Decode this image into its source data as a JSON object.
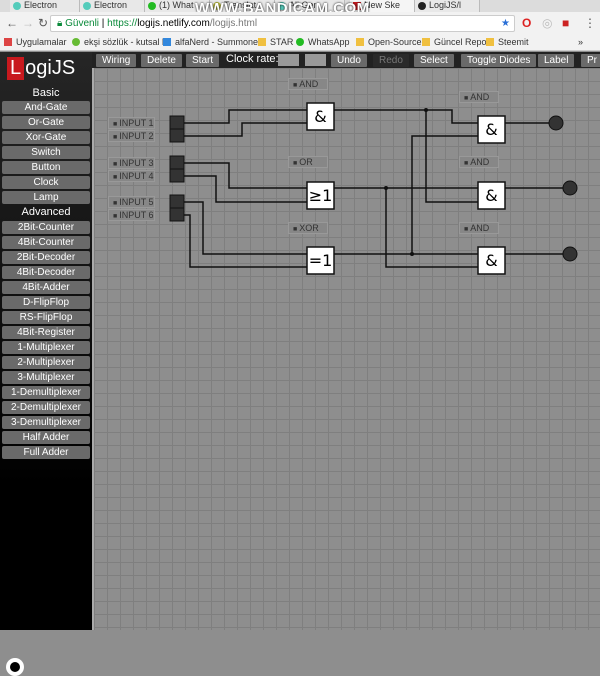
{
  "browser": {
    "tabs": [
      "Electron",
      "Electron",
      "(1) What",
      "Translat",
      "Ali Gen",
      "New Ske",
      "LogiJS/l"
    ],
    "watermark": "WWW.BANDICAM.COM",
    "security": "Güvenli",
    "url_scheme": "https://",
    "url_host": "logijs.netlify.com",
    "url_path": "/logijs.html",
    "bookmarks": [
      "Uygulamalar",
      "ekşi sözlük - kutsal b",
      "alfaNerd - Summone",
      "STAR",
      "WhatsApp",
      "Open-Source",
      "Güncel Repo",
      "Steemit"
    ],
    "more": "»"
  },
  "app": {
    "logo_letter": "L",
    "logo_rest": "ogiJS",
    "basic_heading": "Basic",
    "basic": [
      "And-Gate",
      "Or-Gate",
      "Xor-Gate",
      "Switch",
      "Button",
      "Clock",
      "Lamp"
    ],
    "advanced_heading": "Advanced",
    "advanced": [
      "2Bit-Counter",
      "4Bit-Counter",
      "2Bit-Decoder",
      "4Bit-Decoder",
      "4Bit-Adder",
      "D-FlipFlop",
      "RS-FlipFlop",
      "4Bit-Register",
      "1-Multiplexer",
      "2-Multiplexer",
      "3-Multiplexer",
      "1-Demultiplexer",
      "2-Demultiplexer",
      "3-Demultiplexer",
      "Half Adder",
      "Full Adder"
    ],
    "toolbar": {
      "wiring": "Wiring",
      "delete": "Delete",
      "start": "Start",
      "clock_rate": "Clock rate:",
      "undo": "Undo",
      "redo": "Redo",
      "select": "Select",
      "toggle_diodes": "Toggle Diodes",
      "label": "Label",
      "more": "Pr"
    },
    "inputs": [
      "INPUT 1",
      "INPUT 2",
      "INPUT 3",
      "INPUT 4",
      "INPUT 5",
      "INPUT 6"
    ],
    "gate_labels": [
      "AND",
      "OR",
      "XOR",
      "AND",
      "AND",
      "AND"
    ],
    "gate_symbols": [
      "&",
      "≥1",
      "=1",
      "&",
      "&",
      "&"
    ],
    "colors": {
      "accent": "#c8191e",
      "canvas": "#8e8e8e",
      "lamp_off": "#333333"
    }
  }
}
